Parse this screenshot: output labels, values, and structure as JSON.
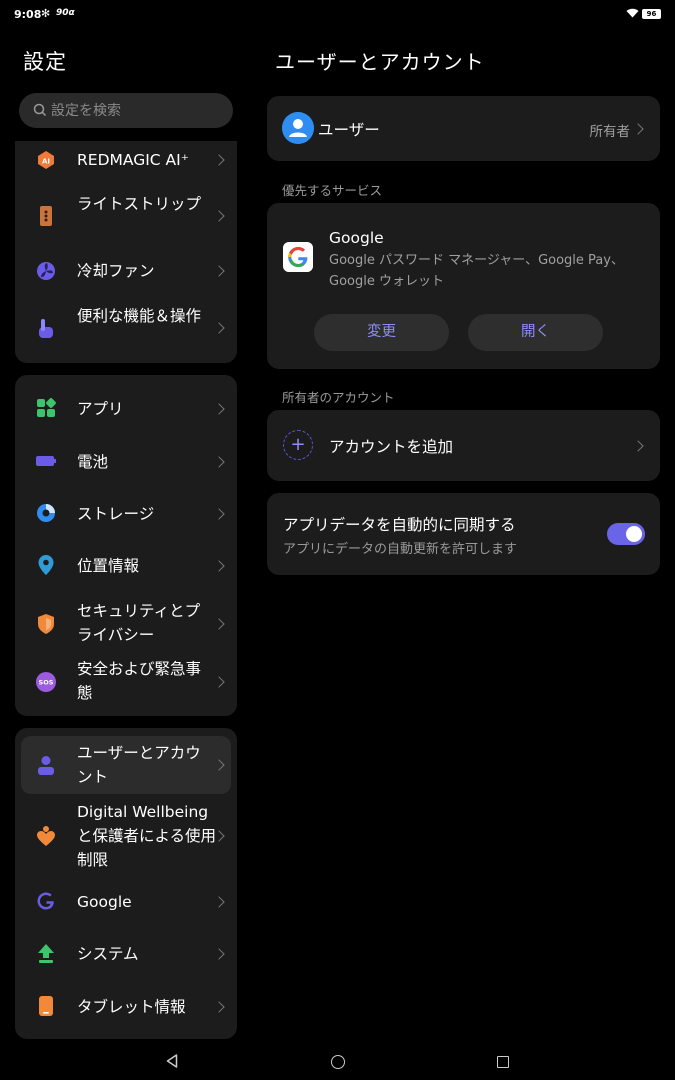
{
  "status_bar": {
    "time": "9:08",
    "refresh": "90",
    "battery": "96"
  },
  "left": {
    "title": "設定",
    "search_placeholder": "設定を検索",
    "group1": [
      {
        "label": "REDMAGIC AI⁺",
        "icon": "ai-icon"
      },
      {
        "label": "ライトストリップ",
        "icon": "light-strip-icon"
      },
      {
        "label": "冷却ファン",
        "icon": "fan-icon"
      },
      {
        "label": "便利な機能＆操作",
        "icon": "gesture-icon"
      }
    ],
    "group2": [
      {
        "label": "アプリ",
        "icon": "apps-icon"
      },
      {
        "label": "電池",
        "icon": "battery-icon"
      },
      {
        "label": "ストレージ",
        "icon": "storage-icon"
      },
      {
        "label": "位置情報",
        "icon": "location-icon"
      },
      {
        "label": "セキュリティとプライバシー",
        "icon": "shield-icon"
      },
      {
        "label": "安全および緊急事態",
        "icon": "sos-icon"
      }
    ],
    "group3": [
      {
        "label": "ユーザーとアカウント",
        "icon": "user-icon"
      },
      {
        "label": "Digital Wellbeing と保護者による使用制限",
        "icon": "wellbeing-icon"
      },
      {
        "label": "Google",
        "icon": "google-icon"
      },
      {
        "label": "システム",
        "icon": "system-update-icon"
      },
      {
        "label": "タブレット情報",
        "icon": "tablet-icon"
      }
    ]
  },
  "right": {
    "title": "ユーザーとアカウント",
    "user": {
      "name": "ユーザー",
      "role": "所有者"
    },
    "preferred_label": "優先するサービス",
    "google": {
      "title": "Google",
      "desc": "Google パスワード マネージャー、Google Pay、Google ウォレット",
      "change": "変更",
      "open": "開く"
    },
    "owner_accounts_label": "所有者のアカウント",
    "add_account": "アカウントを追加",
    "sync": {
      "title": "アプリデータを自動的に同期する",
      "subtitle": "アプリにデータの自動更新を許可します",
      "enabled": true
    }
  },
  "colors": {
    "accent": "#6a64e8",
    "card": "#1c1c1c",
    "background": "#000000"
  }
}
